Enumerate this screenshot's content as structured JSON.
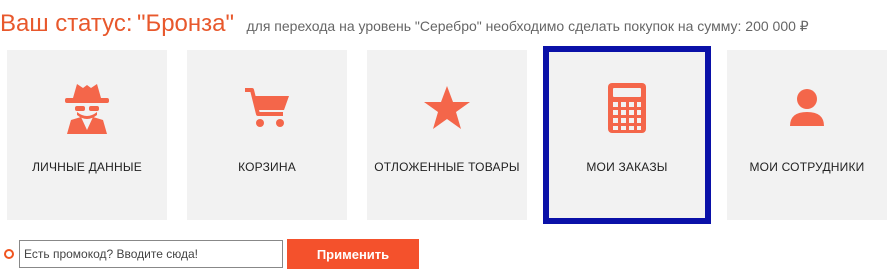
{
  "status": {
    "label": "Ваш статус:",
    "level": "\"Бронза\"",
    "note": "для перехода на уровень \"Серебро\" необходимо сделать покупок на сумму: 200 000 ₽"
  },
  "cards": [
    {
      "title": "ЛИЧНЫЕ ДАННЫЕ",
      "icon": "spy-icon"
    },
    {
      "title": "КОРЗИНА",
      "icon": "cart-icon"
    },
    {
      "title": "ОТЛОЖЕННЫЕ ТОВАРЫ",
      "icon": "star-icon"
    },
    {
      "title": "МОИ ЗАКАЗЫ",
      "icon": "calculator-icon",
      "active": true
    },
    {
      "title": "МОИ СОТРУДНИКИ",
      "icon": "user-icon"
    }
  ],
  "promo": {
    "placeholder": "Есть промокод? Вводите сюда!",
    "button_label": "Применить"
  },
  "colors": {
    "accent": "#f4512c",
    "card_bg": "#f2f2f2",
    "highlight_border": "#0a11a8"
  }
}
